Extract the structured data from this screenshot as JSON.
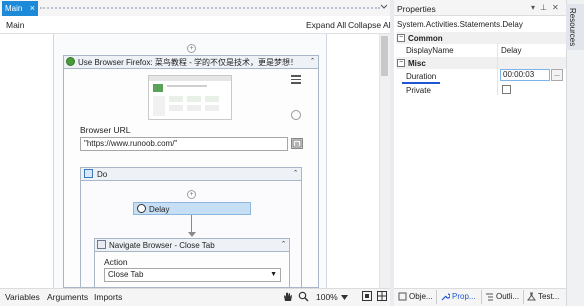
{
  "designer": {
    "tab_title": "Main",
    "tab_close": "×",
    "breadcrumb": "Main",
    "expand_all": "Expand All",
    "collapse_all": "Collapse All",
    "add_symbol": "+",
    "browser_activity": {
      "title": "Use Browser Firefox: 菜鸟教程 - 学的不仅是技术，更是梦想！",
      "collapse_symbol": "⌃",
      "url_label": "Browser URL",
      "url_value": "\"https://www.runoob.com/\""
    },
    "do_sequence": {
      "title": "Do",
      "delay_label": "Delay",
      "navigate": {
        "title": "Navigate Browser - Close Tab",
        "action_label": "Action",
        "action_value": "Close Tab"
      }
    },
    "bottom": {
      "variables": "Variables",
      "arguments": "Arguments",
      "imports": "Imports",
      "zoom": "100%"
    }
  },
  "properties": {
    "title": "Properties",
    "type_name": "System.Activities.Statements.Delay",
    "sections": [
      {
        "name": "Common",
        "rows": [
          {
            "name": "DisplayName",
            "value": "Delay"
          }
        ]
      },
      {
        "name": "Misc",
        "rows": [
          {
            "name": "Duration",
            "value": "00:00:03"
          },
          {
            "name": "Private",
            "value": ""
          }
        ]
      }
    ],
    "ellipsis": "...",
    "bottom_tabs": [
      "Obje...",
      "Prop...",
      "Outli...",
      "Test..."
    ]
  },
  "rail": {
    "tab": "Resources"
  },
  "colors": {
    "tab_accent": "#1c8ad8",
    "delay_fill": "#c7dff4",
    "focus_underline": "#1f56d8"
  }
}
